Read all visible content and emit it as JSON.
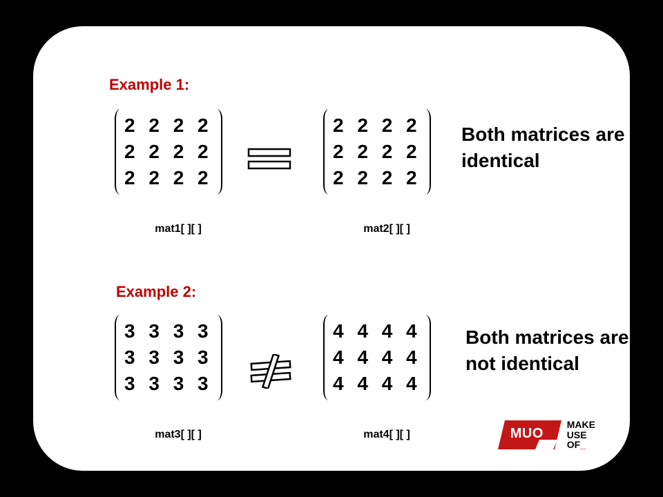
{
  "example1": {
    "label": "Example 1:",
    "matrixA": {
      "caption": "mat1[ ][ ]",
      "rows": [
        "2 2 2 2",
        "2 2 2 2",
        "2 2 2 2"
      ]
    },
    "matrixB": {
      "caption": "mat2[ ][ ]",
      "rows": [
        "2 2 2 2",
        "2 2 2 2",
        "2 2 2 2"
      ]
    },
    "operator": "equals",
    "result": "Both matrices are identical"
  },
  "example2": {
    "label": "Example 2:",
    "matrixA": {
      "caption": "mat3[ ][ ]",
      "rows": [
        "3 3 3 3",
        "3 3 3 3",
        "3 3 3 3"
      ]
    },
    "matrixB": {
      "caption": "mat4[ ][ ]",
      "rows": [
        "4 4 4 4",
        "4 4 4 4",
        "4 4 4 4"
      ]
    },
    "operator": "not-equals",
    "result": "Both matrices are not identical"
  },
  "logo": {
    "badge": "MUO",
    "line1": "MAKE",
    "line2": "USE",
    "line3": "OF",
    "cursor": "_"
  },
  "colors": {
    "accent": "#c00000",
    "brand": "#c21717"
  }
}
